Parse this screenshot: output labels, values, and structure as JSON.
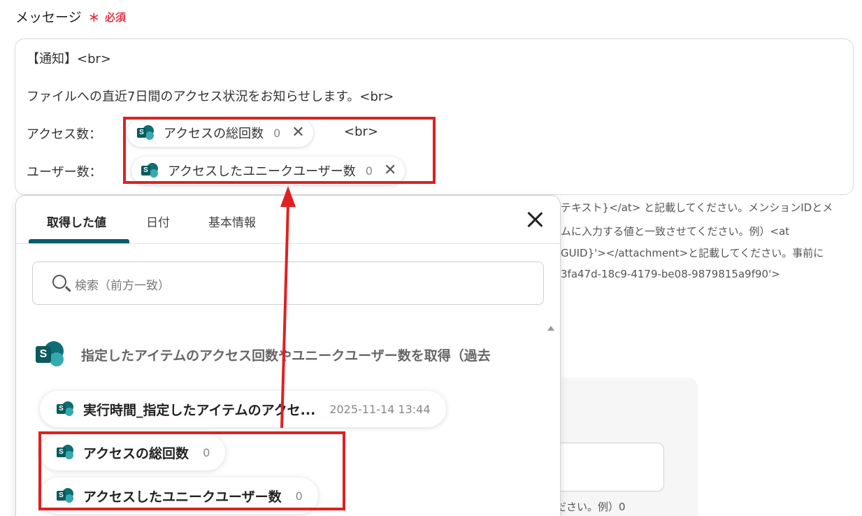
{
  "field": {
    "label": "メッセージ",
    "required_mark": "∗",
    "required_text": "必須"
  },
  "editor": {
    "line1": "【通知】<br>",
    "line2": "ファイルへの直近7日間のアクセス状況をお知らせします。<br>",
    "line3_prefix": "アクセス数：",
    "line3_pill": {
      "label": "アクセスの総回数",
      "value": "0",
      "remove": "✕"
    },
    "line3_suffix": "<br>",
    "line4_prefix": "ユーザー数：",
    "line4_pill": {
      "label": "アクセスしたユニークユーザー数",
      "value": "0",
      "remove": "✕"
    }
  },
  "help_text": [
    "テキスト}</at> と記載してください。メンションIDとメ",
    "ムに入力する値と一致させてください。例）<at",
    "GUID}'></attachment>と記載してください。事前に",
    "3fa47d-18c9-4179-be08-9879815a9f90'>"
  ],
  "background_note": "ださい。例）0",
  "panel": {
    "tabs": [
      "取得した値",
      "日付",
      "基本情報"
    ],
    "active_tab": 0,
    "search_placeholder": "検索（前方一致）",
    "group_title": "指定したアイテムのアクセス回数やユニークユーザー数を取得（過去",
    "items": [
      {
        "label": "実行時間_指定したアイテムのアクセ...",
        "value": "2025-11-14 13:44"
      },
      {
        "label": "アクセスの総回数",
        "value": "0"
      },
      {
        "label": "アクセスしたユニークユーザー数",
        "value": "0"
      }
    ]
  },
  "icons": {
    "sharepoint_letter": "S",
    "pill": "sharepoint-icon",
    "close": "close-icon",
    "search": "search-icon"
  },
  "colors": {
    "annotation_red": "#e02020",
    "required_red": "#e0394b",
    "tab_accent": "#0b5a6e",
    "sharepoint_teal": "#0d6f74"
  }
}
